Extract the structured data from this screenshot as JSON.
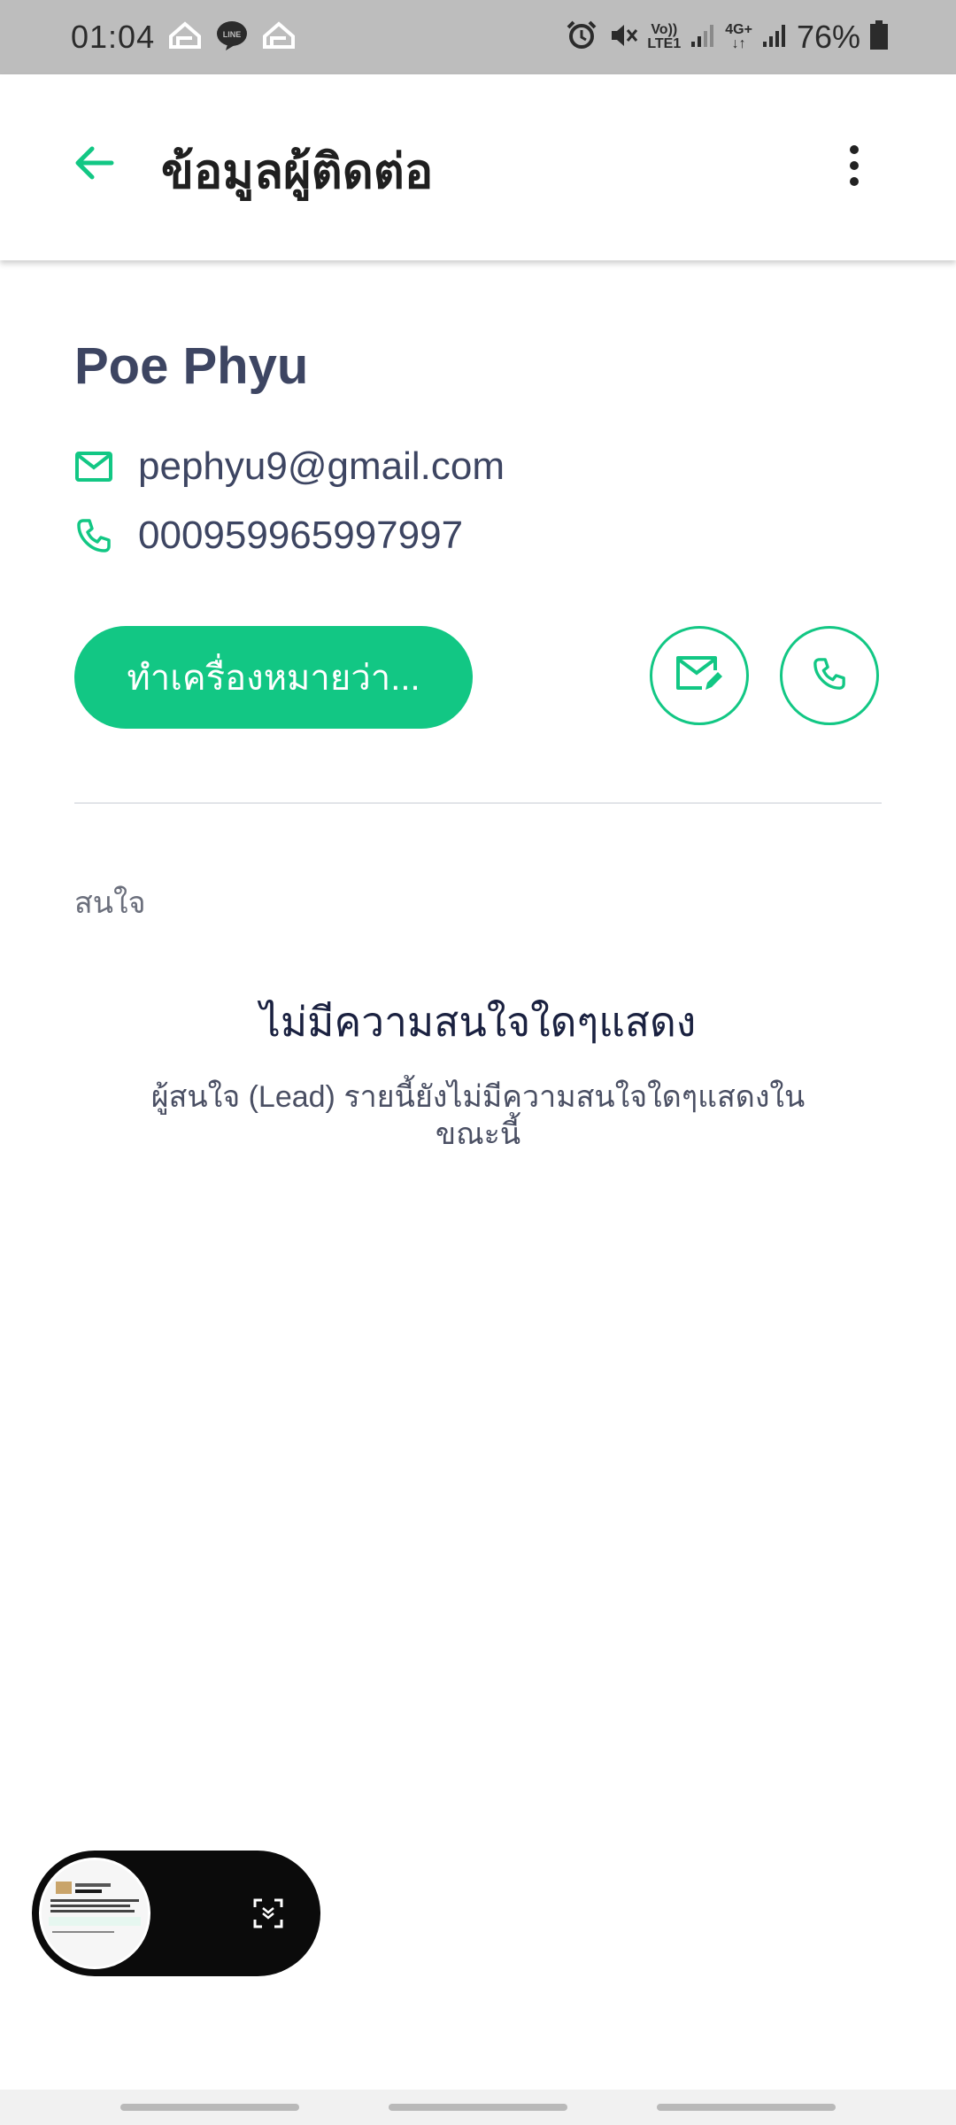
{
  "status_bar": {
    "time": "01:04",
    "battery": "76%",
    "network_labels": [
      "Vo))",
      "LTE1",
      "4G+"
    ],
    "icons": [
      "home-icon",
      "line-icon",
      "home-icon",
      "alarm-icon",
      "mute-icon",
      "signal-icon",
      "signal-icon",
      "battery-icon"
    ]
  },
  "app_bar": {
    "title": "ข้อมูลผู้ติดต่อ",
    "back_icon": "arrow-left-icon",
    "more_icon": "more-vertical-icon"
  },
  "contact": {
    "name": "Poe Phyu",
    "email": "pephyu9@gmail.com",
    "phone": "000959965997997"
  },
  "actions": {
    "mark_as_label": "ทำเครื่องหมายว่า..."
  },
  "interests": {
    "section_label": "สนใจ",
    "empty_title": "ไม่มีความสนใจใดๆแสดง",
    "empty_description": "ผู้สนใจ (Lead) รายนี้ยังไม่มีความสนใจใดๆแสดงในขณะนี้"
  },
  "colors": {
    "accent": "#12c784",
    "text_primary": "#3d4562",
    "status_bar_bg": "#bdbdbd"
  }
}
